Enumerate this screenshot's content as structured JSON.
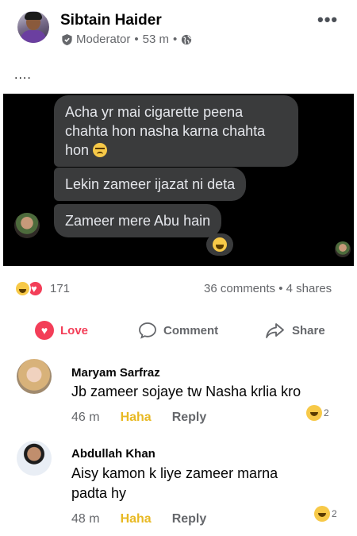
{
  "post": {
    "author": "Sibtain Haider",
    "role": "Moderator",
    "time": "53 m",
    "more": "•••",
    "text": "....",
    "image": {
      "messages": [
        "Acha yr mai cigarette peena chahta hon nasha karna chahta hon",
        "Lekin zameer ijazat ni deta",
        "Zameer mere Abu hain"
      ]
    },
    "reactions_count": "171",
    "comments_shares": "36 comments • 4 shares"
  },
  "actions": {
    "love": "Love",
    "comment": "Comment",
    "share": "Share"
  },
  "comments": [
    {
      "name": "Maryam Sarfraz",
      "text": "Jb zameer sojaye tw Nasha krlia kro",
      "time": "46 m",
      "react_label": "Haha",
      "reply_label": "Reply",
      "react_count": "2"
    },
    {
      "name": "Abdullah Khan",
      "text": "Aisy kamon k liye zameer marna padta hy",
      "time": "48 m",
      "react_label": "Haha",
      "reply_label": "Reply",
      "react_count": "2"
    }
  ]
}
